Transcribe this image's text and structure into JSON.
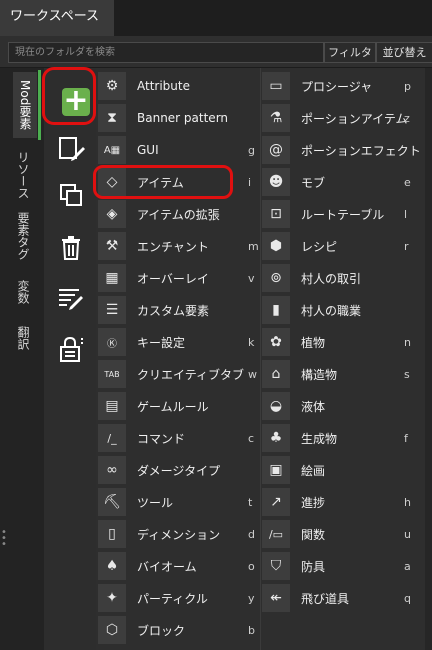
{
  "tab": {
    "label": "ワークスペース"
  },
  "search": {
    "placeholder": "現在のフォルダを検索",
    "filter_label": "フィルタ",
    "sort_label": "並び替え"
  },
  "vtabs": [
    {
      "label": "Mod要素",
      "active": true
    },
    {
      "label": "リソース"
    },
    {
      "label": "要素タグ"
    },
    {
      "label": "変数"
    },
    {
      "label": "翻訳"
    }
  ],
  "tools": [
    {
      "icon": "add-icon",
      "color": "#6ab04c"
    },
    {
      "icon": "edit-file-icon"
    },
    {
      "icon": "duplicate-icon"
    },
    {
      "icon": "trash-icon"
    },
    {
      "icon": "list-edit-icon"
    },
    {
      "icon": "lock-icon"
    }
  ],
  "menu_left": [
    {
      "label": "Attribute",
      "key": "",
      "icon": "attribute-icon"
    },
    {
      "label": "Banner pattern",
      "key": "",
      "icon": "banner-icon"
    },
    {
      "label": "GUI",
      "key": "g",
      "icon": "gui-icon"
    },
    {
      "label": "アイテム",
      "key": "i",
      "icon": "diamond-icon"
    },
    {
      "label": "アイテムの拡張",
      "key": "",
      "icon": "item-extension-icon"
    },
    {
      "label": "エンチャント",
      "key": "m",
      "icon": "enchant-icon"
    },
    {
      "label": "オーバーレイ",
      "key": "v",
      "icon": "overlay-icon"
    },
    {
      "label": "カスタム要素",
      "key": "",
      "icon": "custom-element-icon"
    },
    {
      "label": "キー設定",
      "key": "k",
      "icon": "key-icon"
    },
    {
      "label": "クリエイティブタブ",
      "key": "w",
      "icon": "tab-icon"
    },
    {
      "label": "ゲームルール",
      "key": "",
      "icon": "gamerule-icon"
    },
    {
      "label": "コマンド",
      "key": "c",
      "icon": "command-icon"
    },
    {
      "label": "ダメージタイプ",
      "key": "",
      "icon": "damage-type-icon"
    },
    {
      "label": "ツール",
      "key": "t",
      "icon": "pickaxe-icon"
    },
    {
      "label": "ディメンション",
      "key": "d",
      "icon": "dimension-icon"
    },
    {
      "label": "バイオーム",
      "key": "o",
      "icon": "tree-icon"
    },
    {
      "label": "パーティクル",
      "key": "y",
      "icon": "particle-icon"
    },
    {
      "label": "ブロック",
      "key": "b",
      "icon": "cube-icon"
    }
  ],
  "menu_right": [
    {
      "label": "プロシージャ",
      "key": "p",
      "icon": "folder-icon"
    },
    {
      "label": "ポーションアイテム",
      "key": "z",
      "icon": "flask-icon"
    },
    {
      "label": "ポーションエフェクト",
      "key": "",
      "icon": "spiral-icon"
    },
    {
      "label": "モブ",
      "key": "e",
      "icon": "mob-icon"
    },
    {
      "label": "ルートテーブル",
      "key": "l",
      "icon": "loot-table-icon"
    },
    {
      "label": "レシピ",
      "key": "r",
      "icon": "recipe-icon"
    },
    {
      "label": "村人の取引",
      "key": "",
      "icon": "trade-icon"
    },
    {
      "label": "村人の職業",
      "key": "",
      "icon": "profession-icon"
    },
    {
      "label": "植物",
      "key": "n",
      "icon": "plant-icon"
    },
    {
      "label": "構造物",
      "key": "s",
      "icon": "structure-icon"
    },
    {
      "label": "液体",
      "key": "",
      "icon": "bucket-icon"
    },
    {
      "label": "生成物",
      "key": "f",
      "icon": "feature-icon"
    },
    {
      "label": "絵画",
      "key": "",
      "icon": "painting-icon"
    },
    {
      "label": "進捗",
      "key": "h",
      "icon": "chart-icon"
    },
    {
      "label": "関数",
      "key": "u",
      "icon": "function-icon"
    },
    {
      "label": "防具",
      "key": "a",
      "icon": "armor-icon"
    },
    {
      "label": "飛び道具",
      "key": "q",
      "icon": "arrow-icon"
    }
  ]
}
